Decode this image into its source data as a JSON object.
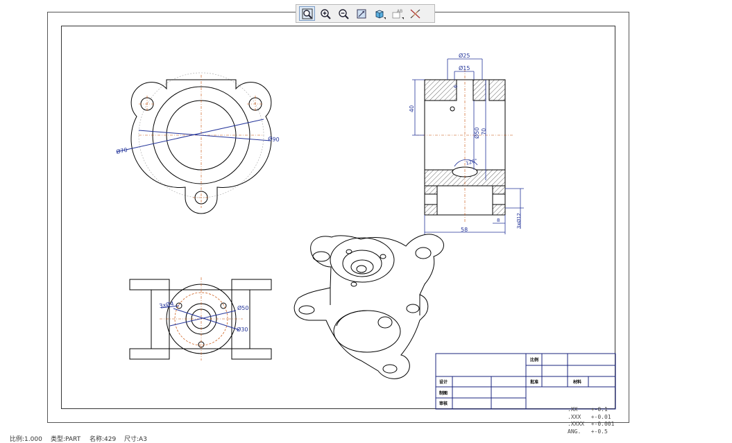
{
  "toolbar": {
    "buttons": [
      {
        "name": "zoom-window-button",
        "icon": "magnifier-window-icon"
      },
      {
        "name": "zoom-in-button",
        "icon": "zoom-in-icon"
      },
      {
        "name": "zoom-out-button",
        "icon": "zoom-out-icon"
      },
      {
        "name": "fit-view-button",
        "icon": "fit-view-icon"
      },
      {
        "name": "shaded-view-button",
        "icon": "cube-icon"
      },
      {
        "name": "annotation-button",
        "icon": "annotation-icon",
        "label": "AB"
      },
      {
        "name": "measure-button",
        "icon": "measure-icon"
      }
    ]
  },
  "dimensions": {
    "d25": "Ø25",
    "d15": "Ø15",
    "h6": "6",
    "h40": "40",
    "d50": "Ø50",
    "h70": "70",
    "angle120": "120°",
    "w58": "58",
    "w8": "8",
    "holes3d12": "3xØ12",
    "d70_top": "Ø70",
    "d90_top": "Ø90",
    "holes3d4": "3xØ4",
    "d50_bot": "Ø50",
    "d30_bot": "Ø30"
  },
  "title_block": {
    "scale_label": "比例",
    "design_label": "设计",
    "check_label": "审核",
    "draw_label": "制图",
    "approve_label": "批准",
    "material_label": "材料"
  },
  "tolerances": [
    ".XX    +-0.1",
    ".XXX   +-0.01",
    ".XXXX  +-0.001",
    "ANG.   +-0.5"
  ],
  "status": {
    "scale": "比例:1.000",
    "type": "类型:PART",
    "name": "名称:429",
    "size": "尺寸:A3"
  }
}
